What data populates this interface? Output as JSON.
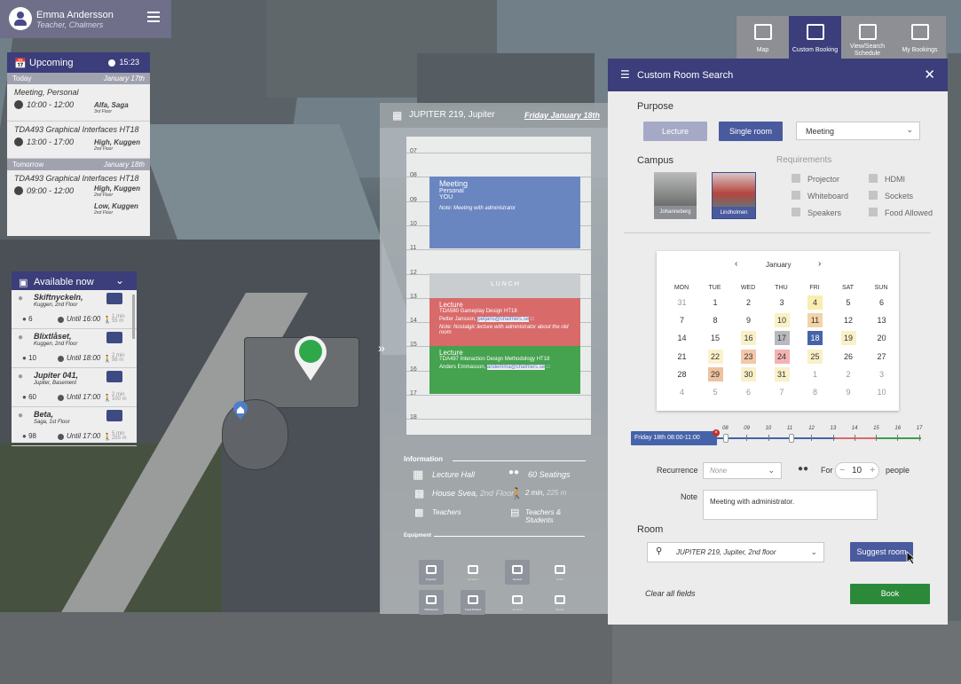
{
  "user": {
    "name": "Emma Andersson",
    "role": "Teacher, Chalmers"
  },
  "upcoming": {
    "title": "Upcoming",
    "time": "15:23",
    "groups": [
      {
        "day": "Today",
        "date": "January 17th",
        "events": [
          {
            "title": "Meeting, Personal",
            "time": "10:00 - 12:00",
            "room": "Alfa, Saga",
            "floor": "3rd Floor"
          },
          {
            "title": "TDA493 Graphical Interfaces HT18",
            "time": "13:00 - 17:00",
            "room": "High, Kuggen",
            "floor": "2nd Floor"
          }
        ]
      },
      {
        "day": "Tomorrow",
        "date": "January 18th",
        "events": [
          {
            "title": "TDA493 Graphical Interfaces HT18",
            "time": "09:00 - 12:00",
            "room": "High, Kuggen",
            "floor": "2nd Floor",
            "room2": "Low, Kuggen",
            "floor2": "2nd Floor"
          }
        ]
      }
    ]
  },
  "available": {
    "title": "Available now",
    "items": [
      {
        "name": "Skiftnyckeln,",
        "sub": "Kuggen, 2nd Floor",
        "people": "6",
        "until": "Until 16:00",
        "walk": "1 min",
        "dist": "55 m"
      },
      {
        "name": "Blixtlåset,",
        "sub": "Kuggen, 2nd Floor",
        "people": "10",
        "until": "Until 18:00",
        "walk": "2 min",
        "dist": "98 m"
      },
      {
        "name": "Jupiter 041,",
        "sub": "Jupiter, Basement",
        "people": "60",
        "until": "Until 17:00",
        "walk": "2 min",
        "dist": "100 m"
      },
      {
        "name": "Beta,",
        "sub": "Saga, 1st Floor",
        "people": "98",
        "until": "Until 17:00",
        "walk": "5 min",
        "dist": "255 m"
      }
    ]
  },
  "detail": {
    "title": "JUPITER 219, Jupiter",
    "date": "Friday January 18th",
    "hours": [
      "07",
      "08",
      "09",
      "10",
      "11",
      "12",
      "13",
      "14",
      "15",
      "16",
      "17",
      "18"
    ],
    "meeting": {
      "title": "Meeting",
      "sub": "Personal",
      "who": "YOU",
      "note": "Note: Meeting with administrator"
    },
    "lunch": "L U N C H",
    "lecture1": {
      "title": "Lecture",
      "course": "TDA580 Gameplay Design HT18",
      "teacher": "Petter Jansson,",
      "email": "petjans@chalmers.se",
      "note": "Note: Nostalgic lecture with administrator about the old room"
    },
    "lecture2": {
      "title": "Lecture",
      "course": "TDA497 Interaction Design Methodology HT18",
      "teacher": "Anders Emmasson,",
      "email": "andemma@chalmers.se"
    },
    "info_title": "Information",
    "type": "Lecture Hall",
    "seats": "60 Seatings",
    "house": "House Svea,",
    "floor": "2nd Floor",
    "walk": "2 min,",
    "dist": "225 m",
    "access1": "Teachers",
    "access2": "Teachers & Students",
    "equip_title": "Equipment",
    "equipment": [
      "Projector",
      "Speakers",
      "Sockets",
      "HDMI",
      "Whiteboard",
      "Food Allowed",
      "Sockets",
      "Repairs"
    ]
  },
  "nav": [
    {
      "label": "Map",
      "icon": "map-icon"
    },
    {
      "label": "Custom Booking",
      "icon": "sliders-icon"
    },
    {
      "label": "View/Search Schedule",
      "icon": "calendar-search-icon"
    },
    {
      "label": "My Bookings",
      "icon": "calendar-icon"
    }
  ],
  "search": {
    "title": "Custom Room Search",
    "purpose": "Purpose",
    "lecture_btn": "Lecture",
    "single_btn": "Single room",
    "purpose_select": "Meeting",
    "campus": "Campus",
    "campus1": "Johanneberg",
    "campus2": "Lindholmen",
    "requirements": "Requirements",
    "reqs": [
      "Projector",
      "HDMI",
      "Whiteboard",
      "Sockets",
      "Speakers",
      "Food Allowed"
    ],
    "month": "January",
    "weekdays": [
      "MON",
      "TUE",
      "WED",
      "THU",
      "FRI",
      "SAT",
      "SUN"
    ],
    "days": [
      [
        "31",
        "1",
        "2",
        "3",
        "4",
        "5",
        "6"
      ],
      [
        "7",
        "8",
        "9",
        "10",
        "11",
        "12",
        "13"
      ],
      [
        "14",
        "15",
        "16",
        "17",
        "18",
        "19",
        "20"
      ],
      [
        "21",
        "22",
        "23",
        "24",
        "25",
        "26",
        "27"
      ],
      [
        "28",
        "29",
        "30",
        "31",
        "1",
        "2",
        "3"
      ],
      [
        "4",
        "5",
        "6",
        "7",
        "8",
        "9",
        "10"
      ]
    ],
    "selected_slot": "Friday 18th  08:00-11:00",
    "ticks": [
      "08",
      "09",
      "10",
      "11",
      "12",
      "13",
      "14",
      "15",
      "16",
      "17"
    ],
    "recurrence_label": "Recurrence",
    "recurrence": "None",
    "for_label": "For",
    "count": "10",
    "people_label": "people",
    "note_label": "Note",
    "note": "Meeting with administrator.",
    "room_label": "Room",
    "room": "JUPITER 219, Jupiter, 2nd floor",
    "suggest": "Suggest room",
    "clear": "Clear all fields",
    "book": "Book"
  }
}
